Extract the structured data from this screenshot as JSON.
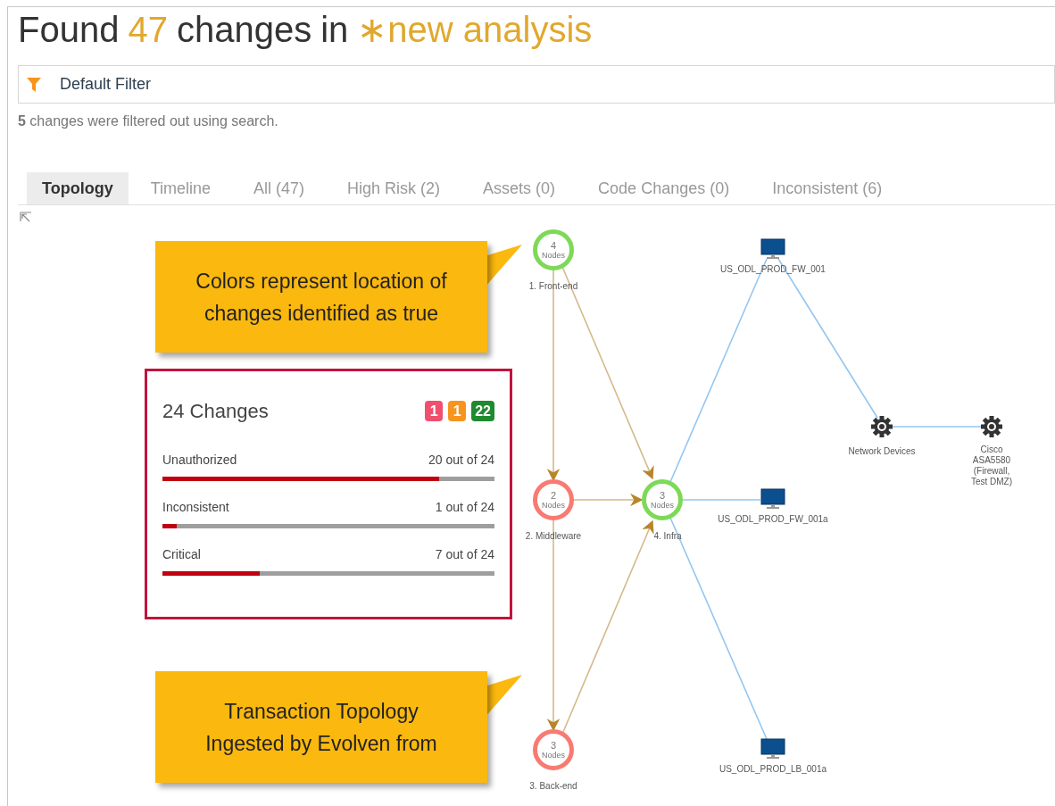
{
  "title": [
    {
      "text": "Found",
      "kind": "plain"
    },
    {
      "text": "47",
      "kind": "highlight"
    },
    {
      "text": "changes",
      "kind": "plain"
    },
    {
      "text": "in",
      "kind": "plain"
    },
    {
      "text": "∗new analysis",
      "kind": "highlight"
    }
  ],
  "filter": {
    "label": "Default Filter"
  },
  "filter_note": "**5** changes were filtered out using search.",
  "tabs": [
    {
      "label": "Topology",
      "selected": true
    },
    {
      "label": "Timeline",
      "selected": false
    },
    {
      "label": "All (47)",
      "selected": false
    },
    {
      "label": "High Risk (2)",
      "selected": false
    },
    {
      "label": "Assets (0)",
      "selected": false
    },
    {
      "label": "Code Changes (0)",
      "selected": false
    },
    {
      "label": "Inconsistent (6)",
      "selected": false
    }
  ],
  "nodes": [
    {
      "kind": "group",
      "count": "4",
      "unit": "Nodes",
      "label": "1. Front-end",
      "color": "#7ed957"
    },
    {
      "kind": "group",
      "count": "2",
      "unit": "Nodes",
      "label": "2. Middleware",
      "color": "#f87a72"
    },
    {
      "kind": "group",
      "count": "3",
      "unit": "Nodes",
      "label": "3. Back-end",
      "color": "#f87a72"
    },
    {
      "kind": "group",
      "count": "3",
      "unit": "Nodes",
      "label": "4. Infra",
      "color": "#7ed957"
    },
    {
      "kind": "monitor",
      "label": "US_ODL_PROD_FW_001"
    },
    {
      "kind": "monitor",
      "label": "US_ODL_PROD_FW_001a"
    },
    {
      "kind": "monitor",
      "label": "US_ODL_PROD_LB_001a"
    },
    {
      "kind": "gear",
      "label": "Network Devices"
    },
    {
      "kind": "gear",
      "label": "Cisco ASA5580 (Firewall, Test DMZ)"
    }
  ],
  "callouts": [
    "Colors represent location of changes identified as true",
    "Transaction Topology Ingested by Evolven from"
  ],
  "card": {
    "title": "24 Changes",
    "badges": [
      {
        "text": "1",
        "color": "#f0506e"
      },
      {
        "text": "1",
        "color": "#f7941d"
      },
      {
        "text": "22",
        "color": "#1f8a2f"
      }
    ],
    "metrics": [
      {
        "label": "Unauthorized",
        "reading": "20 out of 24",
        "level": 0.833
      },
      {
        "label": "Inconsistent",
        "reading": "1 out of 24",
        "level": 0.042
      },
      {
        "label": "Critical",
        "reading": "7 out of 24",
        "level": 0.292
      }
    ]
  }
}
